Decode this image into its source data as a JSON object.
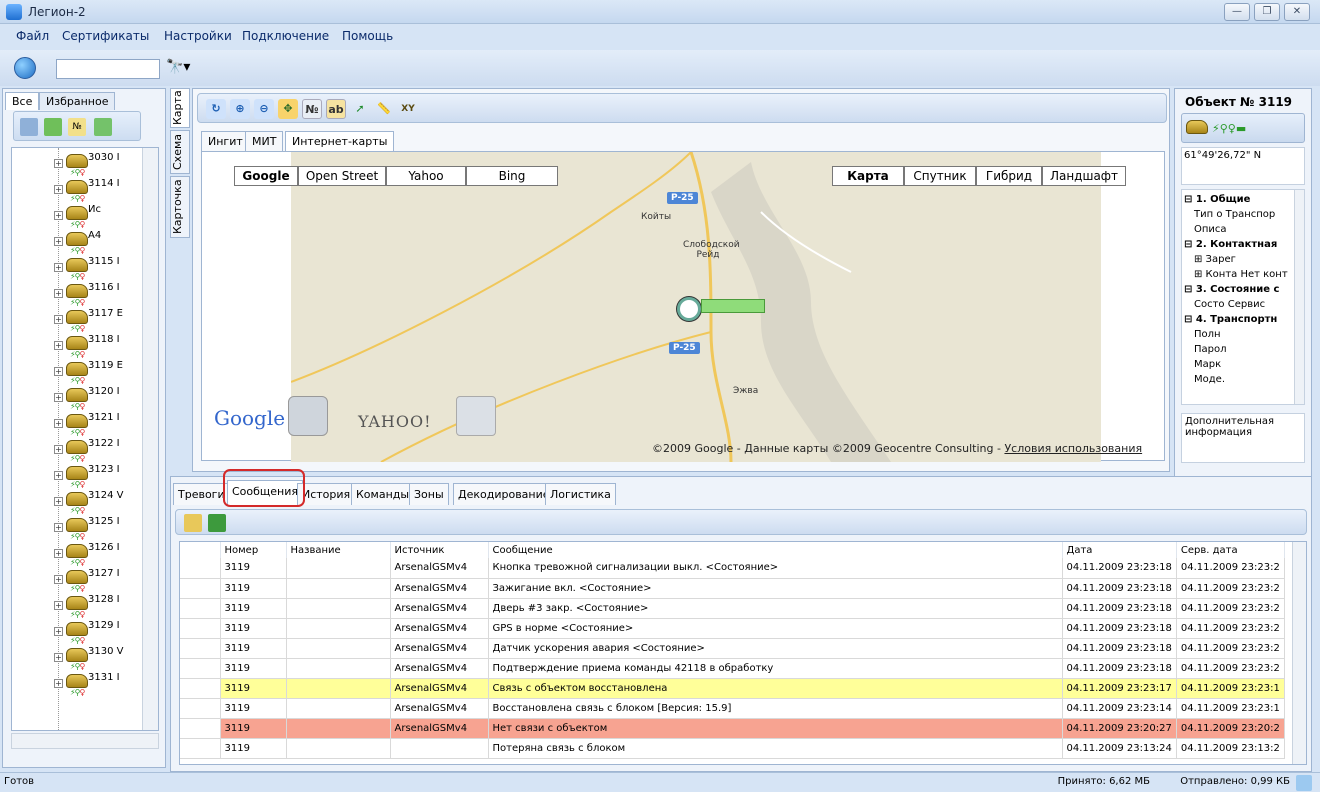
{
  "window": {
    "title": "Легион-2"
  },
  "menu": [
    "Файл",
    "Сертификаты",
    "Настройки",
    "Подключение",
    "Помощь"
  ],
  "left_panel": {
    "tabs": [
      "Все",
      "Избранное"
    ],
    "tree_items": [
      {
        "num": "3030 I"
      },
      {
        "num": "3114 I"
      },
      {
        "num": "Ис"
      },
      {
        "num": "A4"
      },
      {
        "num": "3115 I"
      },
      {
        "num": "3116 I"
      },
      {
        "num": "3117 E"
      },
      {
        "num": "3118 I"
      },
      {
        "num": "3119 E"
      },
      {
        "num": "3120 I"
      },
      {
        "num": "3121 I"
      },
      {
        "num": "3122 I"
      },
      {
        "num": "3123 I"
      },
      {
        "num": "3124 V"
      },
      {
        "num": "3125 I"
      },
      {
        "num": "3126 I"
      },
      {
        "num": "3127 I"
      },
      {
        "num": "3128 I"
      },
      {
        "num": "3129 I"
      },
      {
        "num": "3130 V"
      },
      {
        "num": "3131 I"
      }
    ]
  },
  "side_tabs": [
    "Карта",
    "Схема",
    "Карточка"
  ],
  "map": {
    "tabs": [
      "Ингит",
      "МИТ",
      "Интернет-карты"
    ],
    "providers": [
      "Google",
      "Open Street",
      "Yahoo",
      "Bing"
    ],
    "map_types": [
      "Карта",
      "Спутник",
      "Гибрид",
      "Ландшафт"
    ],
    "road_label": "P-25",
    "towns": [
      "Койты",
      "Слободской Рейд",
      "Эжва"
    ],
    "logo_google": "Google",
    "logo_yahoo": "YAHOO!",
    "copyright": "©2009 Google - Данные карты ©2009 Geocentre Consulting - ",
    "terms_link": "Условия использования"
  },
  "right_panel": {
    "title": "Объект № 3119",
    "coordinate": "61°49'26,72\" N",
    "properties": [
      {
        "cat": true,
        "text": "⊟ 1. Общие"
      },
      {
        "cat": false,
        "text": "Тип о Транспор"
      },
      {
        "cat": false,
        "text": "Описа"
      },
      {
        "cat": true,
        "text": "⊟ 2. Контактная"
      },
      {
        "cat": false,
        "text": "⊞ Зарег"
      },
      {
        "cat": false,
        "text": "⊞ Конта Нет конт"
      },
      {
        "cat": true,
        "text": "⊟ 3. Состояние с"
      },
      {
        "cat": false,
        "text": "Состо Сервис"
      },
      {
        "cat": true,
        "text": "⊟ 4. Транспортн"
      },
      {
        "cat": false,
        "text": "Полн"
      },
      {
        "cat": false,
        "text": "Парол"
      },
      {
        "cat": false,
        "text": "Марк"
      },
      {
        "cat": false,
        "text": "Моде."
      }
    ],
    "additional_info": "Дополнительная информация"
  },
  "bottom": {
    "tabs": [
      "Тревоги",
      "Сообщения",
      "История",
      "Команды",
      "Зоны",
      "Декодирование",
      "Логистика"
    ],
    "active_tab": "Сообщения",
    "columns": [
      "Номер",
      "Название",
      "Источник",
      "Сообщение",
      "Дата",
      "Серв. дата"
    ],
    "rows": [
      {
        "num": "3119",
        "name": "",
        "src": "ArsenalGSMv4",
        "msg": "Кнопка тревожной сигнализации выкл. <Состояние>",
        "date": "04.11.2009 23:23:18",
        "sdate": "04.11.2009 23:23:2",
        "hl": ""
      },
      {
        "num": "3119",
        "name": "",
        "src": "ArsenalGSMv4",
        "msg": "Зажигание вкл. <Состояние>",
        "date": "04.11.2009 23:23:18",
        "sdate": "04.11.2009 23:23:2",
        "hl": ""
      },
      {
        "num": "3119",
        "name": "",
        "src": "ArsenalGSMv4",
        "msg": "Дверь #3 закр. <Состояние>",
        "date": "04.11.2009 23:23:18",
        "sdate": "04.11.2009 23:23:2",
        "hl": ""
      },
      {
        "num": "3119",
        "name": "",
        "src": "ArsenalGSMv4",
        "msg": "GPS в норме <Состояние>",
        "date": "04.11.2009 23:23:18",
        "sdate": "04.11.2009 23:23:2",
        "hl": ""
      },
      {
        "num": "3119",
        "name": "",
        "src": "ArsenalGSMv4",
        "msg": "Датчик ускорения авария <Состояние>",
        "date": "04.11.2009 23:23:18",
        "sdate": "04.11.2009 23:23:2",
        "hl": ""
      },
      {
        "num": "3119",
        "name": "",
        "src": "ArsenalGSMv4",
        "msg": "Подтверждение приема команды 42118 в обработку",
        "date": "04.11.2009 23:23:18",
        "sdate": "04.11.2009 23:23:2",
        "hl": ""
      },
      {
        "num": "3119",
        "name": "",
        "src": "ArsenalGSMv4",
        "msg": "Связь с объектом восстановлена",
        "date": "04.11.2009 23:23:17",
        "sdate": "04.11.2009 23:23:1",
        "hl": "yellow"
      },
      {
        "num": "3119",
        "name": "",
        "src": "ArsenalGSMv4",
        "msg": "Восстановлена связь с блоком [Версия: 15.9]",
        "date": "04.11.2009 23:23:14",
        "sdate": "04.11.2009 23:23:1",
        "hl": ""
      },
      {
        "num": "3119",
        "name": "",
        "src": "ArsenalGSMv4",
        "msg": "Нет связи с объектом",
        "date": "04.11.2009 23:20:27",
        "date_hl": "",
        "sdate": "04.11.2009 23:20:2",
        "hl": "red"
      },
      {
        "num": "3119",
        "name": "",
        "src": "",
        "msg": "Потеряна связь с блоком",
        "date": "04.11.2009 23:13:24",
        "sdate": "04.11.2009 23:13:2",
        "hl": ""
      }
    ]
  },
  "status": {
    "left": "Готов",
    "received": "Принято: 6,62 МБ",
    "sent": "Отправлено: 0,99 КБ"
  },
  "colors": {
    "row_yellow": "#ffff99",
    "row_red": "#f7a391",
    "highlight": "#d42a2a"
  }
}
